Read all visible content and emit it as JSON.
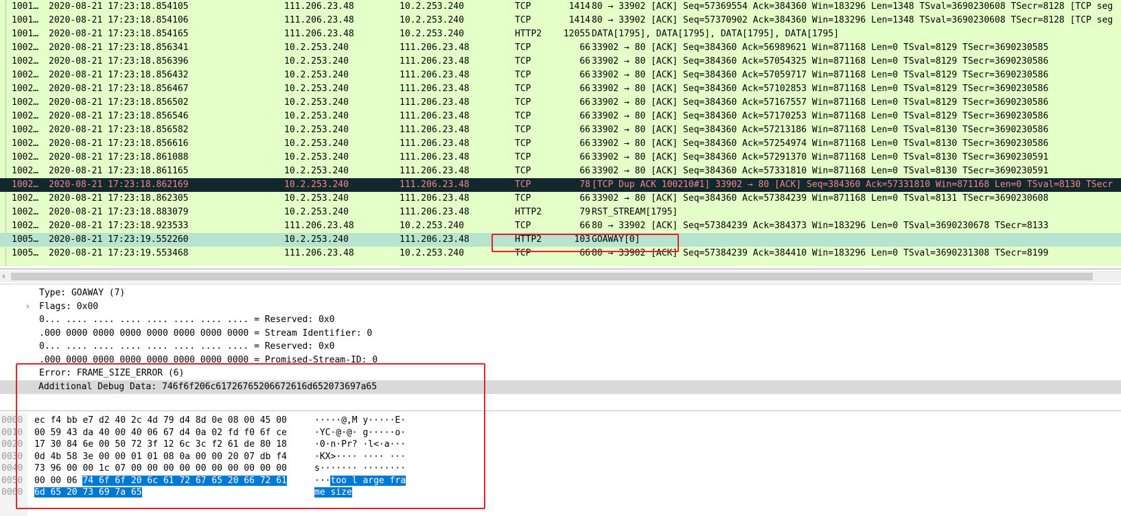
{
  "packets": [
    {
      "no": "1001…",
      "time": "2020-08-21 17:23:18.854105",
      "src": "111.206.23.48",
      "dst": "10.2.253.240",
      "proto": "TCP",
      "len": "1414",
      "info": "80 → 33902 [ACK] Seq=57369554 Ack=384360 Win=183296 Len=1348 TSval=3690230608 TSecr=8128 [TCP seg"
    },
    {
      "no": "1001…",
      "time": "2020-08-21 17:23:18.854106",
      "src": "111.206.23.48",
      "dst": "10.2.253.240",
      "proto": "TCP",
      "len": "1414",
      "info": "80 → 33902 [ACK] Seq=57370902 Ack=384360 Win=183296 Len=1348 TSval=3690230608 TSecr=8128 [TCP seg"
    },
    {
      "no": "1001…",
      "time": "2020-08-21 17:23:18.854165",
      "src": "111.206.23.48",
      "dst": "10.2.253.240",
      "proto": "HTTP2",
      "len": "12055",
      "info": "DATA[1795], DATA[1795], DATA[1795], DATA[1795]"
    },
    {
      "no": "1002…",
      "time": "2020-08-21 17:23:18.856341",
      "src": "10.2.253.240",
      "dst": "111.206.23.48",
      "proto": "TCP",
      "len": "66",
      "info": "33902 → 80 [ACK] Seq=384360 Ack=56989621 Win=871168 Len=0 TSval=8129 TSecr=3690230585"
    },
    {
      "no": "1002…",
      "time": "2020-08-21 17:23:18.856396",
      "src": "10.2.253.240",
      "dst": "111.206.23.48",
      "proto": "TCP",
      "len": "66",
      "info": "33902 → 80 [ACK] Seq=384360 Ack=57054325 Win=871168 Len=0 TSval=8129 TSecr=3690230586"
    },
    {
      "no": "1002…",
      "time": "2020-08-21 17:23:18.856432",
      "src": "10.2.253.240",
      "dst": "111.206.23.48",
      "proto": "TCP",
      "len": "66",
      "info": "33902 → 80 [ACK] Seq=384360 Ack=57059717 Win=871168 Len=0 TSval=8129 TSecr=3690230586"
    },
    {
      "no": "1002…",
      "time": "2020-08-21 17:23:18.856467",
      "src": "10.2.253.240",
      "dst": "111.206.23.48",
      "proto": "TCP",
      "len": "66",
      "info": "33902 → 80 [ACK] Seq=384360 Ack=57102853 Win=871168 Len=0 TSval=8129 TSecr=3690230586"
    },
    {
      "no": "1002…",
      "time": "2020-08-21 17:23:18.856502",
      "src": "10.2.253.240",
      "dst": "111.206.23.48",
      "proto": "TCP",
      "len": "66",
      "info": "33902 → 80 [ACK] Seq=384360 Ack=57167557 Win=871168 Len=0 TSval=8129 TSecr=3690230586"
    },
    {
      "no": "1002…",
      "time": "2020-08-21 17:23:18.856546",
      "src": "10.2.253.240",
      "dst": "111.206.23.48",
      "proto": "TCP",
      "len": "66",
      "info": "33902 → 80 [ACK] Seq=384360 Ack=57170253 Win=871168 Len=0 TSval=8129 TSecr=3690230586"
    },
    {
      "no": "1002…",
      "time": "2020-08-21 17:23:18.856582",
      "src": "10.2.253.240",
      "dst": "111.206.23.48",
      "proto": "TCP",
      "len": "66",
      "info": "33902 → 80 [ACK] Seq=384360 Ack=57213186 Win=871168 Len=0 TSval=8130 TSecr=3690230586"
    },
    {
      "no": "1002…",
      "time": "2020-08-21 17:23:18.856616",
      "src": "10.2.253.240",
      "dst": "111.206.23.48",
      "proto": "TCP",
      "len": "66",
      "info": "33902 → 80 [ACK] Seq=384360 Ack=57254974 Win=871168 Len=0 TSval=8130 TSecr=3690230586"
    },
    {
      "no": "1002…",
      "time": "2020-08-21 17:23:18.861088",
      "src": "10.2.253.240",
      "dst": "111.206.23.48",
      "proto": "TCP",
      "len": "66",
      "info": "33902 → 80 [ACK] Seq=384360 Ack=57291370 Win=871168 Len=0 TSval=8130 TSecr=3690230591"
    },
    {
      "no": "1002…",
      "time": "2020-08-21 17:23:18.861165",
      "src": "10.2.253.240",
      "dst": "111.206.23.48",
      "proto": "TCP",
      "len": "66",
      "info": "33902 → 80 [ACK] Seq=384360 Ack=57331810 Win=871168 Len=0 TSval=8130 TSecr=3690230591"
    },
    {
      "no": "1002…",
      "time": "2020-08-21 17:23:18.862169",
      "src": "10.2.253.240",
      "dst": "111.206.23.48",
      "proto": "TCP",
      "len": "78",
      "info": "[TCP Dup ACK 100210#1] 33902 → 80 [ACK] Seq=384360 Ack=57331810 Win=871168 Len=0 TSval=8130 TSecr"
    },
    {
      "no": "1002…",
      "time": "2020-08-21 17:23:18.862305",
      "src": "10.2.253.240",
      "dst": "111.206.23.48",
      "proto": "TCP",
      "len": "66",
      "info": "33902 → 80 [ACK] Seq=384360 Ack=57384239 Win=871168 Len=0 TSval=8131 TSecr=3690230608"
    },
    {
      "no": "1002…",
      "time": "2020-08-21 17:23:18.883079",
      "src": "10.2.253.240",
      "dst": "111.206.23.48",
      "proto": "HTTP2",
      "len": "79",
      "info": "RST_STREAM[1795]"
    },
    {
      "no": "1002…",
      "time": "2020-08-21 17:23:18.923533",
      "src": "111.206.23.48",
      "dst": "10.2.253.240",
      "proto": "TCP",
      "len": "66",
      "info": "80 → 33902 [ACK] Seq=57384239 Ack=384373 Win=183296 Len=0 TSval=3690230678 TSecr=8133"
    },
    {
      "no": "1005…",
      "time": "2020-08-21 17:23:19.552260",
      "src": "10.2.253.240",
      "dst": "111.206.23.48",
      "proto": "HTTP2",
      "len": "103",
      "info": "GOAWAY[0]"
    },
    {
      "no": "1005…",
      "time": "2020-08-21 17:23:19.553468",
      "src": "111.206.23.48",
      "dst": "10.2.253.240",
      "proto": "TCP",
      "len": "66",
      "info": "80 → 33902 [ACK] Seq=57384239 Ack=384410 Win=183296 Len=0 TSval=3690231308 TSecr=8199"
    }
  ],
  "selected_row": 13,
  "highlight_row": 17,
  "scrollbar": {
    "left_arrow": "‹"
  },
  "details": {
    "expander": "›",
    "lines": [
      "Type: GOAWAY (7)",
      "Flags: 0x00",
      "0... .... .... .... .... .... .... .... = Reserved: 0x0",
      ".000 0000 0000 0000 0000 0000 0000 0000 = Stream Identifier: 0",
      "0... .... .... .... .... .... .... .... = Reserved: 0x0",
      ".000 0000 0000 0000 0000 0000 0000 0000 = Promised-Stream-ID: 0",
      "Error: FRAME_SIZE_ERROR (6)",
      "Additional Debug Data: 746f6f206c61726765206672616d652073697a65"
    ]
  },
  "bytes": [
    {
      "offset": "0000",
      "hex": "ec f4 bb e7 d2 40 2c 4d  79 d4 8d 0e 08 00 45 00",
      "hex_sel": "",
      "ascii": "·····@,M y·····E·",
      "ascii_sel": ""
    },
    {
      "offset": "0010",
      "hex": "00 59 43 da 40 00 40 06  67 d4 0a 02 fd f0 6f ce",
      "hex_sel": "",
      "ascii": "·YC·@·@· g·····o·",
      "ascii_sel": ""
    },
    {
      "offset": "0020",
      "hex": "17 30 84 6e 00 50 72 3f  12 6c 3c f2 61 de 80 18",
      "hex_sel": "",
      "ascii": "·0·n·Pr? ·l<·a···",
      "ascii_sel": ""
    },
    {
      "offset": "0030",
      "hex": "0d 4b 58 3e 00 00 01 01  08 0a 00 00 20 07 db f4",
      "hex_sel": "",
      "ascii": "·KX>···· ···· ···",
      "ascii_sel": ""
    },
    {
      "offset": "0040",
      "hex": "73 96 00 00 1c 07 00 00  00 00 00 00 00 00 00 00",
      "hex_sel": "",
      "ascii": "s······· ········",
      "ascii_sel": ""
    },
    {
      "offset": "0050",
      "hex": "00 00 06 ",
      "hex_sel": "74 6f 6f 20 6c  61 72 67 65 20 66 72 61",
      "ascii": "···",
      "ascii_sel": "too l arge fra"
    },
    {
      "offset": "0060",
      "hex": "",
      "hex_sel": "6d 65 20 73 69 7a 65",
      "ascii": "",
      "ascii_sel": "me size"
    }
  ],
  "colors": {
    "tcp_row_bg": "#e4ffc7",
    "selected_row_bg": "#12272e",
    "selected_row_fg": "#f78787",
    "highlight_row_bg": "#b7e4cf",
    "byte_selection": "#0078d7",
    "annotation_red": "#e8202a"
  }
}
